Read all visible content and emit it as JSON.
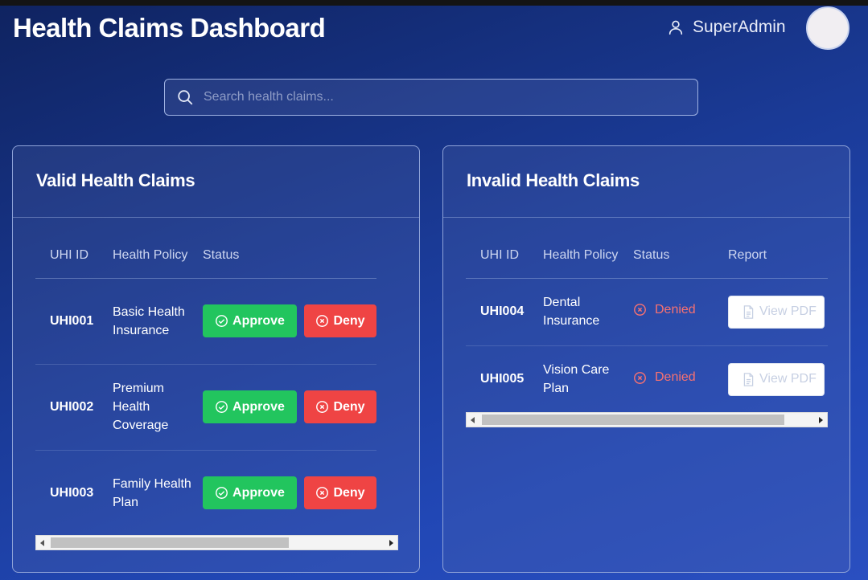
{
  "header": {
    "title": "Health Claims Dashboard",
    "user_name": "SuperAdmin"
  },
  "search": {
    "placeholder": "Search health claims..."
  },
  "valid_panel": {
    "title": "Valid Health Claims",
    "columns": [
      "UHI ID",
      "Health Policy",
      "Status"
    ],
    "rows": [
      {
        "id": "UHI001",
        "policy": "Basic Health Insurance",
        "approve_label": "Approve",
        "deny_label": "Deny"
      },
      {
        "id": "UHI002",
        "policy": "Premium Health Coverage",
        "approve_label": "Approve",
        "deny_label": "Deny"
      },
      {
        "id": "UHI003",
        "policy": "Family Health Plan",
        "approve_label": "Approve",
        "deny_label": "Deny"
      }
    ]
  },
  "invalid_panel": {
    "title": "Invalid Health Claims",
    "columns": [
      "UHI ID",
      "Health Policy",
      "Status",
      "Report"
    ],
    "rows": [
      {
        "id": "UHI004",
        "policy": "Dental Insurance",
        "status": "Denied",
        "report_label": "View PDF"
      },
      {
        "id": "UHI005",
        "policy": "Vision Care Plan",
        "status": "Denied",
        "report_label": "View PDF"
      }
    ]
  },
  "colors": {
    "approve": "#22c55e",
    "deny": "#ef4444",
    "denied_text": "#f87171",
    "background_start": "#0f2360",
    "background_end": "#2a4fc0"
  },
  "icons": [
    "user-icon",
    "search-icon",
    "check-circle-icon",
    "x-circle-icon",
    "file-icon",
    "scroll-left-arrow-icon",
    "scroll-right-arrow-icon"
  ]
}
